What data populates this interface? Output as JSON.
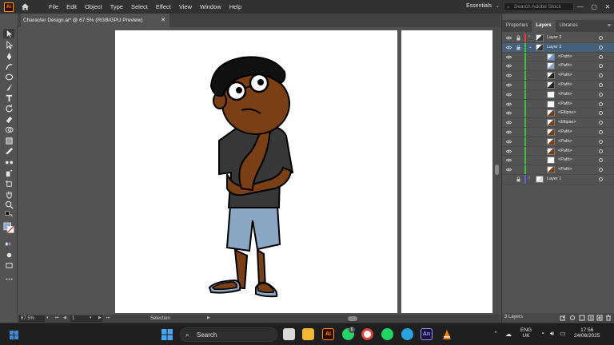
{
  "menubar": {
    "items": [
      "File",
      "Edit",
      "Object",
      "Type",
      "Select",
      "Effect",
      "View",
      "Window",
      "Help"
    ],
    "workspace": "Essentials",
    "search_placeholder": "Search Adobe Stock",
    "app_logo": "Ai"
  },
  "document": {
    "tab_title": "Character Design.ai* @ 67.5% (RGB/GPU Preview)"
  },
  "statusbar": {
    "zoom": "67.5%",
    "page": "1",
    "tool": "Selection"
  },
  "panel": {
    "tabs": [
      "Properties",
      "Layers",
      "Libraries"
    ],
    "active_tab": "Layers",
    "layers": [
      {
        "name": "Layer 2",
        "color": "#e04040",
        "expanded": false,
        "top": true
      },
      {
        "name": "Layer 3",
        "color": "#40c040",
        "expanded": true,
        "top": true
      },
      {
        "name": "<Path>"
      },
      {
        "name": "<Path>"
      },
      {
        "name": "<Path>"
      },
      {
        "name": "<Path>"
      },
      {
        "name": "<Path>"
      },
      {
        "name": "<Path>"
      },
      {
        "name": "<Ellipse>"
      },
      {
        "name": "<Ellipse>"
      },
      {
        "name": "<Path>"
      },
      {
        "name": "<Path>"
      },
      {
        "name": "<Path>"
      },
      {
        "name": "<Path>"
      },
      {
        "name": "<Path>"
      },
      {
        "name": "Layer 1",
        "color": "#6060e0",
        "expanded": false,
        "top": true,
        "hidden": true
      }
    ],
    "layer_count": "3 Layers"
  },
  "taskbar": {
    "search_label": "Search",
    "lang_line1": "ENG",
    "lang_line2": "UK",
    "time": "17:56",
    "date": "24/06/2025",
    "adobe_label": "Ai",
    "animate_label": "An",
    "whatsapp_badge": "6"
  }
}
